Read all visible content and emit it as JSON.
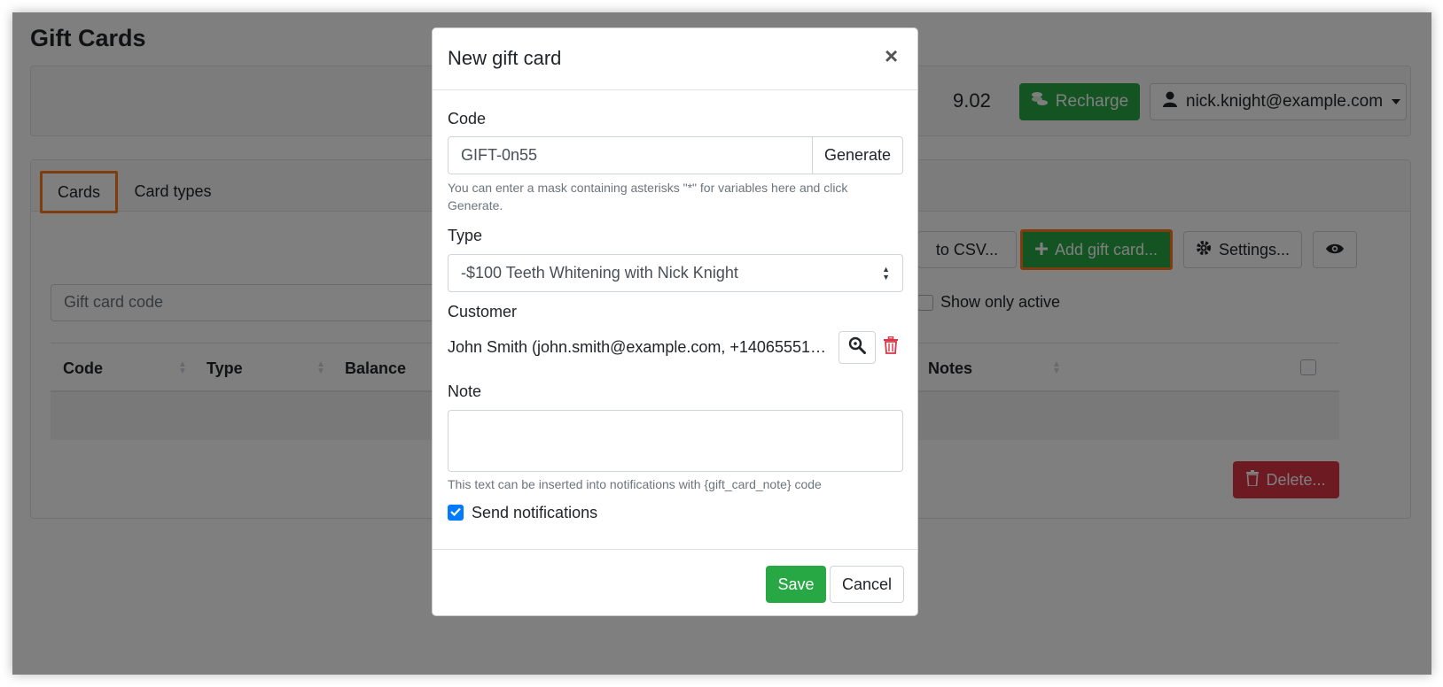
{
  "page": {
    "title": "Gift Cards"
  },
  "topbar": {
    "balance": "9.02",
    "recharge_label": "Recharge",
    "user_email": "nick.knight@example.com"
  },
  "tabs": [
    {
      "label": "Cards",
      "active": true
    },
    {
      "label": "Card types",
      "active": false
    }
  ],
  "toolbar": {
    "export_label": "to CSV...",
    "add_label": "Add gift card...",
    "settings_label": "Settings...",
    "delete_label": "Delete..."
  },
  "filters": {
    "search_placeholder": "Gift card code",
    "show_only_active_label": "Show only active"
  },
  "table": {
    "columns": [
      "Code",
      "Type",
      "Balance",
      "Notes"
    ]
  },
  "modal": {
    "title": "New gift card",
    "code_label": "Code",
    "code_value": "GIFT-0n55",
    "generate_label": "Generate",
    "code_help": "You can enter a mask containing asterisks \"*\" for variables here and click Generate.",
    "type_label": "Type",
    "type_value": "-$100 Teeth Whitening with Nick Knight",
    "customer_label": "Customer",
    "customer_value": "John Smith (john.smith@example.com, +140655512...",
    "note_label": "Note",
    "note_value": "",
    "note_help": "This text can be inserted into notifications with {gift_card_note} code",
    "send_notifications_label": "Send notifications",
    "send_notifications_checked": true,
    "save_label": "Save",
    "cancel_label": "Cancel"
  },
  "colors": {
    "success": "#28a745",
    "danger": "#dc3545",
    "primary": "#007bff",
    "highlight": "#ff7a1a"
  }
}
